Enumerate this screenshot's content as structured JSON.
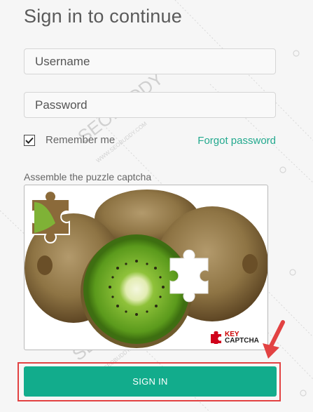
{
  "form": {
    "title": "Sign in to continue",
    "username_placeholder": "Username",
    "password_placeholder": "Password",
    "remember_label": "Remember me",
    "remember_checked": true,
    "forgot_label": "Forgot password",
    "captcha_label": "Assemble the puzzle captcha",
    "captcha_logo_key": "KEY",
    "captcha_logo_captcha": "CAPTCHA",
    "signin_label": "SIGN IN"
  },
  "watermark": {
    "text": "SEOBUDDY",
    "subtext": "WWW.SEOBUDDY.COM"
  },
  "colors": {
    "accent": "#12ac8c",
    "link": "#23a98e",
    "highlight": "#e24242"
  }
}
